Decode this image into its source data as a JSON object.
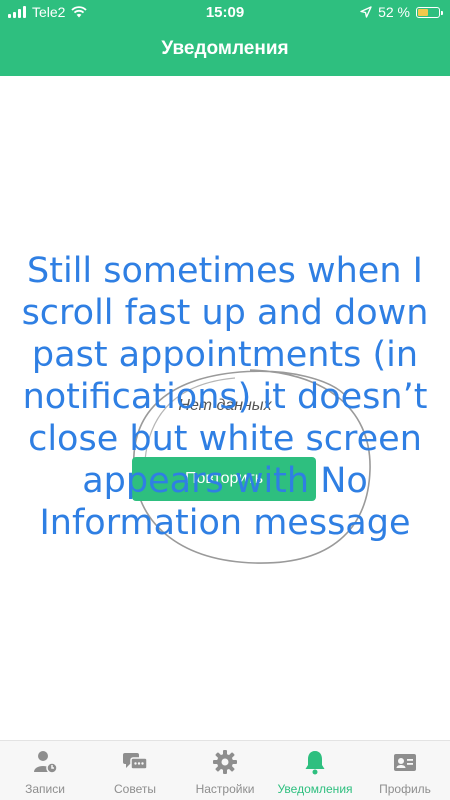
{
  "status": {
    "carrier": "Tele2",
    "time": "15:09",
    "battery_percent": "52 %",
    "battery_level": 0.52
  },
  "header": {
    "title": "Уведомления"
  },
  "main": {
    "empty_text": "Нет данных",
    "retry_label": "Повторить",
    "annotation": "Still sometimes when I scroll fast up and down past appointments (in notifications) it doesn’t close but white screen appears with No Information message"
  },
  "tabbar": {
    "items": [
      {
        "label": "Записи",
        "icon": "appointments-icon"
      },
      {
        "label": "Советы",
        "icon": "chat-icon"
      },
      {
        "label": "Настройки",
        "icon": "gear-icon"
      },
      {
        "label": "Уведомления",
        "icon": "bell-icon",
        "active": true
      },
      {
        "label": "Профиль",
        "icon": "profile-card-icon"
      }
    ]
  },
  "colors": {
    "accent": "#2ebf7f",
    "annotation": "#2f7fe3"
  }
}
